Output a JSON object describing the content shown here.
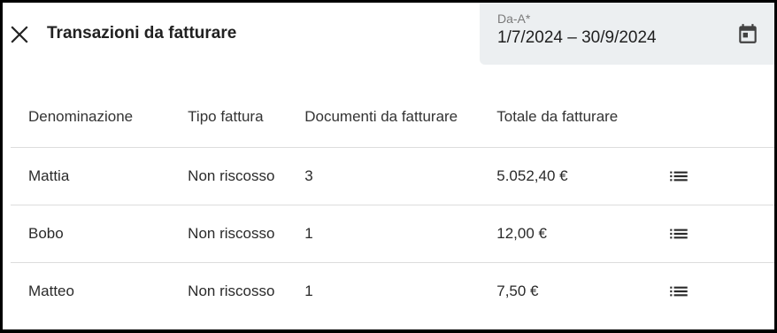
{
  "dialog": {
    "title": "Transazioni da fatturare",
    "close_icon": "close-icon"
  },
  "date_range": {
    "label": "Da-A*",
    "value": "1/7/2024 – 30/9/2024",
    "icon": "calendar-icon"
  },
  "table": {
    "columns": [
      "Denominazione",
      "Tipo fattura",
      "Documenti da fatturare",
      "Totale da fatturare"
    ],
    "rows": [
      {
        "denominazione": "Mattia",
        "tipo": "Non riscosso",
        "documenti": "3",
        "totale": "5.052,40 €"
      },
      {
        "denominazione": "Bobo",
        "tipo": "Non riscosso",
        "documenti": "1",
        "totale": "12,00 €"
      },
      {
        "denominazione": "Matteo",
        "tipo": "Non riscosso",
        "documenti": "1",
        "totale": "7,50 €"
      }
    ],
    "row_action_icon": "list-icon"
  },
  "colors": {
    "surface": "#ffffff",
    "frame": "#000000",
    "field_background": "#eceff1",
    "divider": "#dddddd",
    "text": "#212121"
  }
}
